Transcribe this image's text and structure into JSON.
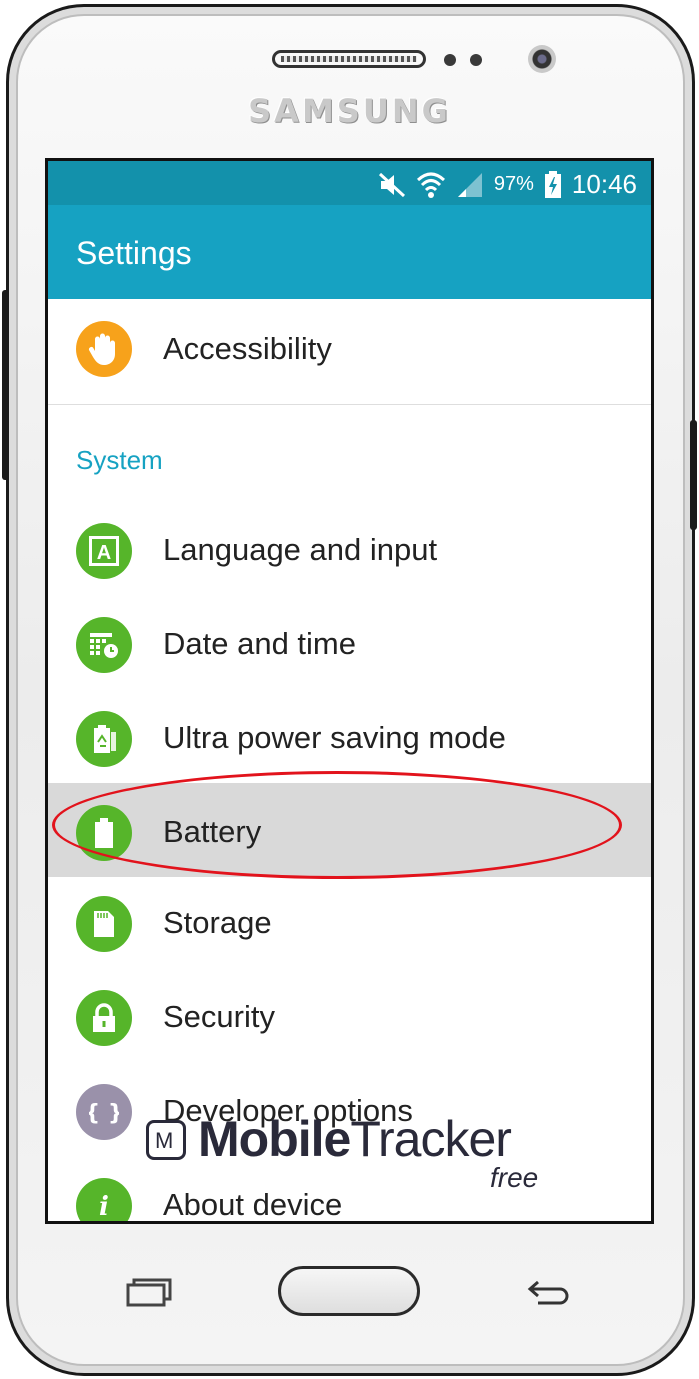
{
  "device": {
    "brand": "SAMSUNG"
  },
  "status_bar": {
    "battery": "97%",
    "time": "10:46"
  },
  "app_bar": {
    "title": "Settings"
  },
  "settings": {
    "accessibility": "Accessibility",
    "section_system": "System",
    "items": [
      {
        "label": "Language and input",
        "icon": "language-icon",
        "color": "#56b52a"
      },
      {
        "label": "Date and time",
        "icon": "calendar-clock-icon",
        "color": "#56b52a"
      },
      {
        "label": "Ultra power saving mode",
        "icon": "power-saving-icon",
        "color": "#56b52a"
      },
      {
        "label": "Battery",
        "icon": "battery-icon",
        "color": "#56b52a",
        "selected": true
      },
      {
        "label": "Storage",
        "icon": "sd-card-icon",
        "color": "#56b52a"
      },
      {
        "label": "Security",
        "icon": "lock-icon",
        "color": "#56b52a"
      },
      {
        "label": "Developer options",
        "icon": "braces-icon",
        "color": "#9a91aa"
      },
      {
        "label": "About device",
        "icon": "info-icon",
        "color": "#56b52a"
      }
    ]
  },
  "watermark": {
    "name_part1": "Mobile",
    "name_part2": "Tracker",
    "tag": "free",
    "logo_letter": "M"
  },
  "colors": {
    "status_bar": "#1391ab",
    "app_bar": "#16a2c2",
    "accent": "#16a2c2",
    "highlight": "#e2131c"
  }
}
